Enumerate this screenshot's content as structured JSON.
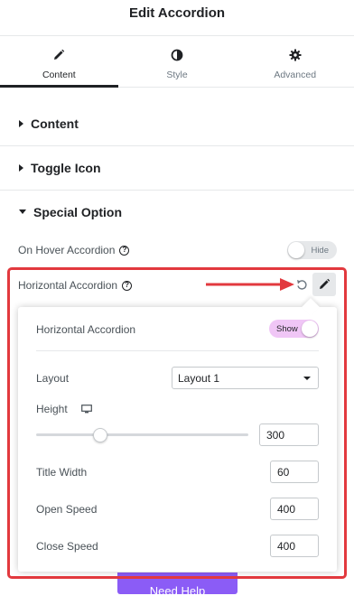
{
  "header": {
    "title": "Edit Accordion"
  },
  "tabs": [
    {
      "label": "Content",
      "icon": "pencil-icon",
      "active": true
    },
    {
      "label": "Style",
      "icon": "half-circle-icon",
      "active": false
    },
    {
      "label": "Advanced",
      "icon": "gear-icon",
      "active": false
    }
  ],
  "sections": {
    "content": "Content",
    "toggle_icon": "Toggle Icon",
    "special_option": "Special Option"
  },
  "controls": {
    "on_hover_accordion": {
      "label": "On Hover Accordion",
      "toggle": "Hide",
      "enabled": false
    },
    "horizontal_accordion": {
      "label": "Horizontal Accordion"
    }
  },
  "popover": {
    "horizontal_accordion": {
      "label": "Horizontal Accordion",
      "toggle": "Show",
      "enabled": true
    },
    "layout": {
      "label": "Layout",
      "value": "Layout 1"
    },
    "height": {
      "label": "Height",
      "value": "300",
      "slider_fraction": 0.3
    },
    "title_width": {
      "label": "Title Width",
      "value": "60"
    },
    "open_speed": {
      "label": "Open Speed",
      "value": "400"
    },
    "close_speed": {
      "label": "Close Speed",
      "value": "400"
    }
  },
  "footer": {
    "need_help": "Need Help"
  },
  "colors": {
    "accent_red": "#e2393e",
    "toggle_on": "#f0c6f6",
    "button_purple": "#8b5cf6"
  }
}
